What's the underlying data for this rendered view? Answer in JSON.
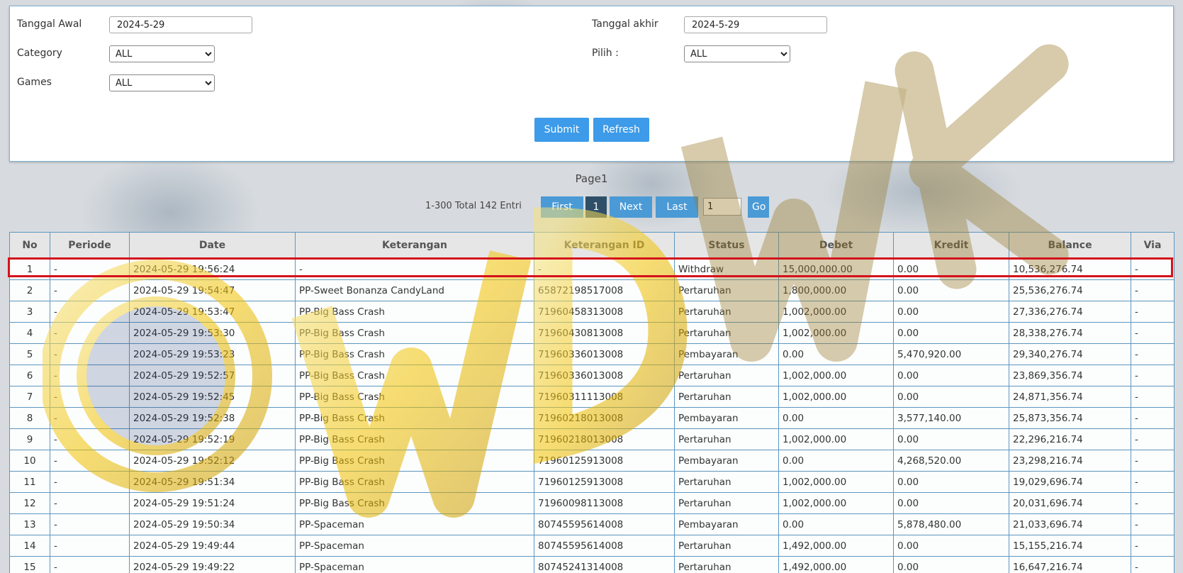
{
  "filters": {
    "start_date_label": "Tanggal Awal",
    "start_date_value": "2024-5-29",
    "end_date_label": "Tanggal akhir",
    "end_date_value": "2024-5-29",
    "category_label": "Category",
    "category_value": "ALL",
    "pilih_label": "Pilih  :",
    "pilih_value": "ALL",
    "games_label": "Games",
    "games_value": "ALL",
    "submit_label": "Submit",
    "refresh_label": "Refresh"
  },
  "pager": {
    "page_title": "Page1",
    "range_text": "1-300 Total 142 Entri",
    "first_label": "First",
    "current_page": "1",
    "next_label": "Next",
    "last_label": "Last",
    "page_input_value": "1",
    "go_label": "Go"
  },
  "table": {
    "headers": [
      "No",
      "Periode",
      "Date",
      "Keterangan",
      "Keterangan ID",
      "Status",
      "Debet",
      "Kredit",
      "Balance",
      "Via"
    ],
    "rows": [
      [
        "1",
        "-",
        "2024-05-29 19:56:24",
        "-",
        "-",
        "Withdraw",
        "15,000,000.00",
        "0.00",
        "10,536,276.74",
        "-"
      ],
      [
        "2",
        "-",
        "2024-05-29 19:54:47",
        "PP-Sweet Bonanza CandyLand",
        "65872198517008",
        "Pertaruhan",
        "1,800,000.00",
        "0.00",
        "25,536,276.74",
        "-"
      ],
      [
        "3",
        "-",
        "2024-05-29 19:53:47",
        "PP-Big Bass Crash",
        "71960458313008",
        "Pertaruhan",
        "1,002,000.00",
        "0.00",
        "27,336,276.74",
        "-"
      ],
      [
        "4",
        "-",
        "2024-05-29 19:53:30",
        "PP-Big Bass Crash",
        "71960430813008",
        "Pertaruhan",
        "1,002,000.00",
        "0.00",
        "28,338,276.74",
        "-"
      ],
      [
        "5",
        "-",
        "2024-05-29 19:53:23",
        "PP-Big Bass Crash",
        "71960336013008",
        "Pembayaran",
        "0.00",
        "5,470,920.00",
        "29,340,276.74",
        "-"
      ],
      [
        "6",
        "-",
        "2024-05-29 19:52:57",
        "PP-Big Bass Crash",
        "71960336013008",
        "Pertaruhan",
        "1,002,000.00",
        "0.00",
        "23,869,356.74",
        "-"
      ],
      [
        "7",
        "-",
        "2024-05-29 19:52:45",
        "PP-Big Bass Crash",
        "71960311113008",
        "Pertaruhan",
        "1,002,000.00",
        "0.00",
        "24,871,356.74",
        "-"
      ],
      [
        "8",
        "-",
        "2024-05-29 19:52:38",
        "PP-Big Bass Crash",
        "71960218013008",
        "Pembayaran",
        "0.00",
        "3,577,140.00",
        "25,873,356.74",
        "-"
      ],
      [
        "9",
        "-",
        "2024-05-29 19:52:19",
        "PP-Big Bass Crash",
        "71960218013008",
        "Pertaruhan",
        "1,002,000.00",
        "0.00",
        "22,296,216.74",
        "-"
      ],
      [
        "10",
        "-",
        "2024-05-29 19:52:12",
        "PP-Big Bass Crash",
        "71960125913008",
        "Pembayaran",
        "0.00",
        "4,268,520.00",
        "23,298,216.74",
        "-"
      ],
      [
        "11",
        "-",
        "2024-05-29 19:51:34",
        "PP-Big Bass Crash",
        "71960125913008",
        "Pertaruhan",
        "1,002,000.00",
        "0.00",
        "19,029,696.74",
        "-"
      ],
      [
        "12",
        "-",
        "2024-05-29 19:51:24",
        "PP-Big Bass Crash",
        "71960098113008",
        "Pertaruhan",
        "1,002,000.00",
        "0.00",
        "20,031,696.74",
        "-"
      ],
      [
        "13",
        "-",
        "2024-05-29 19:50:34",
        "PP-Spaceman",
        "80745595614008",
        "Pembayaran",
        "0.00",
        "5,878,480.00",
        "21,033,696.74",
        "-"
      ],
      [
        "14",
        "-",
        "2024-05-29 19:49:44",
        "PP-Spaceman",
        "80745595614008",
        "Pertaruhan",
        "1,492,000.00",
        "0.00",
        "15,155,216.74",
        "-"
      ],
      [
        "15",
        "-",
        "2024-05-29 19:49:22",
        "PP-Spaceman",
        "80745241314008",
        "Pertaruhan",
        "1,492,000.00",
        "0.00",
        "16,647,216.74",
        "-"
      ]
    ]
  },
  "colors": {
    "accent_button": "#3d9be9",
    "highlight_border": "#d4121c",
    "highlight_text": "#d0102a",
    "table_border": "#5e97c0"
  }
}
